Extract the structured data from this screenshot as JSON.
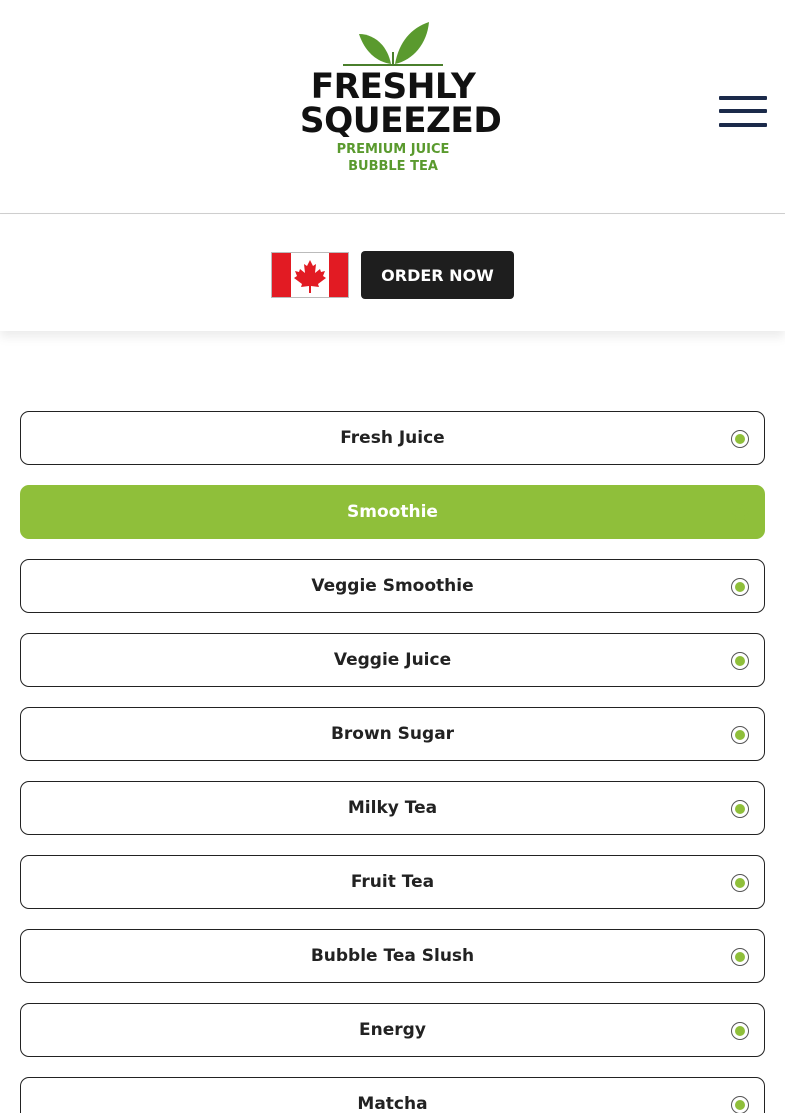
{
  "brand": {
    "word1": "FRESHLY",
    "word2": "SQUEEZED",
    "tagline1": "PREMIUM JUICE",
    "tagline2": "BUBBLE TEA",
    "green": "#5a9a2e",
    "dark": "#111111"
  },
  "header": {
    "menu_icon": "hamburger-menu-icon"
  },
  "subbar": {
    "flag_icon": "canada-flag-icon",
    "order_label": "ORDER NOW"
  },
  "categories": {
    "active_color": "#8fbf3a",
    "items": [
      {
        "label": "Fresh Juice",
        "active": false
      },
      {
        "label": "Smoothie",
        "active": true
      },
      {
        "label": "Veggie Smoothie",
        "active": false
      },
      {
        "label": "Veggie Juice",
        "active": false
      },
      {
        "label": "Brown Sugar",
        "active": false
      },
      {
        "label": "Milky Tea",
        "active": false
      },
      {
        "label": "Fruit Tea",
        "active": false
      },
      {
        "label": "Bubble Tea Slush",
        "active": false
      },
      {
        "label": "Energy",
        "active": false
      },
      {
        "label": "Matcha",
        "active": false
      }
    ]
  }
}
